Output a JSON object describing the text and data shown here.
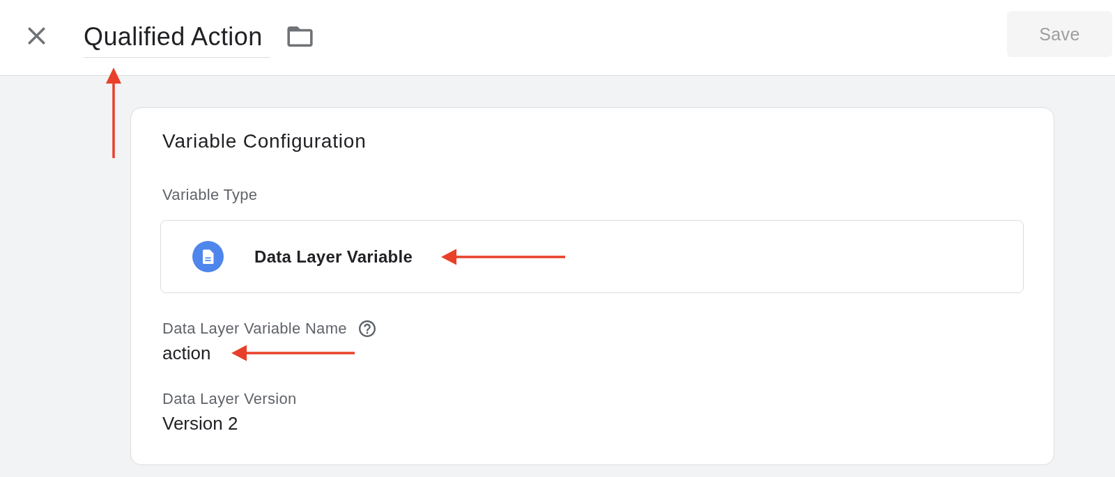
{
  "header": {
    "title": {
      "value": "Qualified Action",
      "highlighted": true
    },
    "save_button": {
      "label": "Save",
      "disabled": true
    }
  },
  "card": {
    "title": "Variable Configuration",
    "fields": [
      {
        "kind": "type",
        "label": "Variable Type",
        "value": "Data Layer Variable",
        "highlighted": true
      },
      {
        "kind": "text",
        "label": "Data Layer Variable Name",
        "value": "action",
        "help": true,
        "highlighted": true
      },
      {
        "kind": "text",
        "label": "Data Layer Version",
        "value": "Version 2"
      }
    ]
  }
}
